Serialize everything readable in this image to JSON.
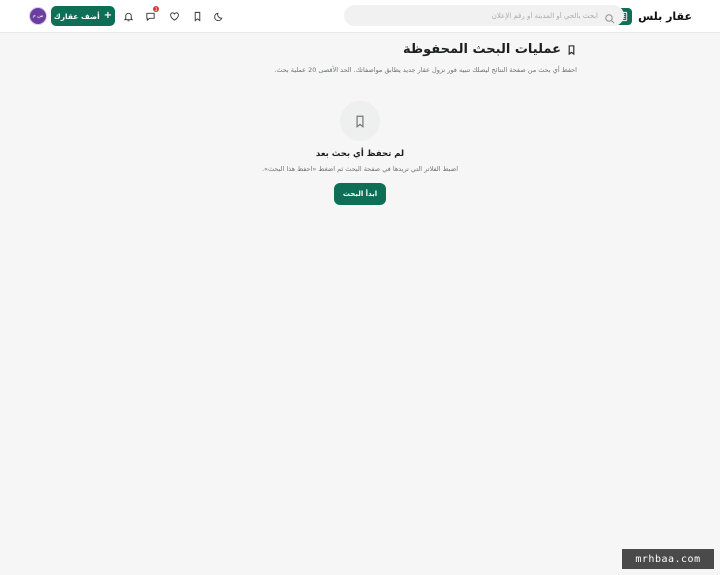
{
  "header": {
    "brand_name": "عقار بلس",
    "search_placeholder": "ابحث بالحي أو المدينة أو رقم الإعلان",
    "notifications_badge": "3",
    "add_property_label": "أضف عقارك",
    "avatar_initials": "س م"
  },
  "main": {
    "title": "عمليات البحث المحفوظة",
    "description": "احفظ أي بحث من صفحة النتائج ليصلك تنبيه فور نزول عقار جديد يطابق مواصفاتك. الحد الأقصى 20 عملية بحث.",
    "empty_title": "لم تحفظ أي بحث بعد",
    "empty_description": "اضبط الفلاتر التي تريدها في صفحة البحث ثم اضغط «احفظ هذا البحث».",
    "start_button_label": "ابدأ البحث"
  },
  "watermark": "mrhbaa.com",
  "colors": {
    "primary": "#0f6e56",
    "badge": "#d23b3b",
    "avatar": "#6a3fa0",
    "background": "#f5f6f5"
  },
  "icons": [
    "building-icon",
    "search-icon",
    "moon-icon",
    "bookmark-icon",
    "heart-icon",
    "chat-icon",
    "bell-icon",
    "plus-icon"
  ]
}
